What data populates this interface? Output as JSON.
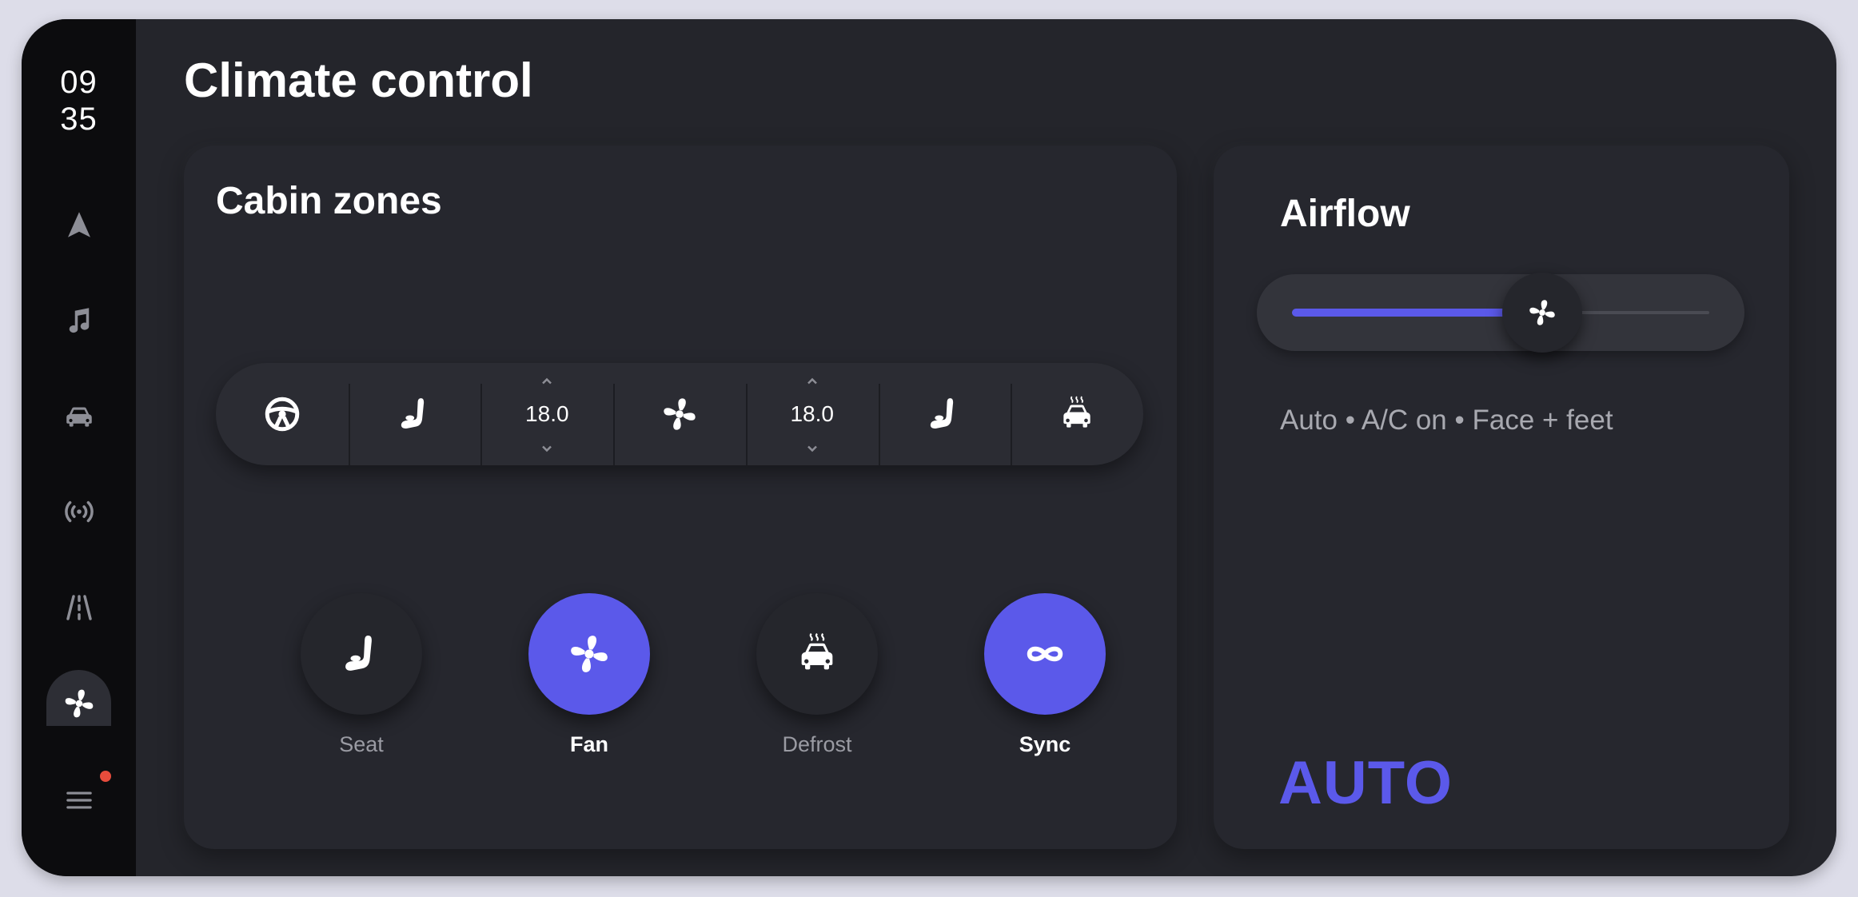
{
  "clock": {
    "hour": "09",
    "minute": "35"
  },
  "nav": {
    "items": [
      {
        "icon": "navigation-icon"
      },
      {
        "icon": "music-icon"
      },
      {
        "icon": "car-icon"
      },
      {
        "icon": "radio-signal-icon"
      },
      {
        "icon": "road-icon"
      },
      {
        "icon": "fan-icon",
        "active": true
      },
      {
        "icon": "menu-icon",
        "notification": true
      }
    ]
  },
  "page": {
    "title": "Climate control"
  },
  "zones": {
    "title": "Cabin zones",
    "bar": {
      "items": [
        "steering-wheel-icon",
        "seat-icon",
        "temp-left",
        "fan-icon",
        "temp-right",
        "seat-icon",
        "defrost-icon"
      ],
      "left_temp": "18.0",
      "right_temp": "18.0"
    },
    "quick_actions": [
      {
        "label": "Seat",
        "icon": "seat-icon",
        "active": false
      },
      {
        "label": "Fan",
        "icon": "fan-icon",
        "active": true
      },
      {
        "label": "Defrost",
        "icon": "defrost-icon",
        "active": false
      },
      {
        "label": "Sync",
        "icon": "sync-icon",
        "active": true
      }
    ]
  },
  "airflow": {
    "title": "Airflow",
    "level": 0.6,
    "status": "Auto • A/C on • Face + feet",
    "mode": "AUTO"
  },
  "colors": {
    "accent": "#5b59ea",
    "background": "#24252b",
    "card": "#26272e",
    "rail": "#0c0c0e",
    "notification": "#e74c3c"
  }
}
